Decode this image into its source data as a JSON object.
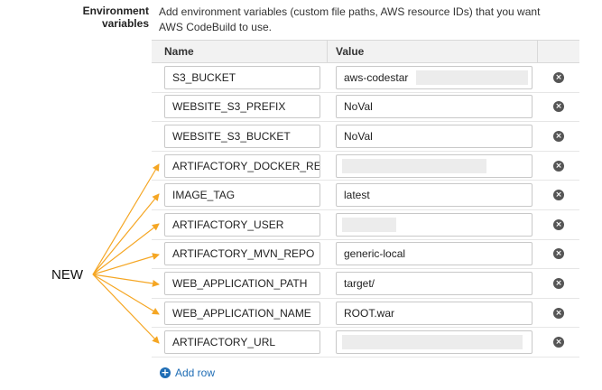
{
  "section": {
    "label": "Environment variables",
    "description": "Add environment variables (custom file paths, AWS resource IDs) that you want AWS CodeBuild to use."
  },
  "table": {
    "headers": {
      "name": "Name",
      "value": "Value"
    },
    "rows": [
      {
        "name": "S3_BUCKET",
        "value": "aws-codestar",
        "value_redacted": true
      },
      {
        "name": "WEBSITE_S3_PREFIX",
        "value": "NoVal",
        "value_redacted": false
      },
      {
        "name": "WEBSITE_S3_BUCKET",
        "value": "NoVal",
        "value_redacted": false
      },
      {
        "name": "ARTIFACTORY_DOCKER_REPO",
        "value": "",
        "value_redacted": true
      },
      {
        "name": "IMAGE_TAG",
        "value": "latest",
        "value_redacted": false
      },
      {
        "name": "ARTIFACTORY_USER",
        "value": "",
        "value_redacted": true
      },
      {
        "name": "ARTIFACTORY_MVN_REPO",
        "value": "generic-local",
        "value_redacted": false
      },
      {
        "name": "WEB_APPLICATION_PATH",
        "value": "target/",
        "value_redacted": false
      },
      {
        "name": "WEB_APPLICATION_NAME",
        "value": "ROOT.war",
        "value_redacted": false
      },
      {
        "name": "ARTIFACTORY_URL",
        "value": "",
        "value_redacted": true
      }
    ],
    "remove_icon": "remove-circle-icon"
  },
  "add_row": {
    "label": "Add row",
    "icon": "plus-circle-icon"
  },
  "annotation": {
    "label": "NEW",
    "arrow_color": "#f5a623"
  },
  "colors": {
    "link": "#1f6db5",
    "header_bg": "#f2f2f2"
  }
}
